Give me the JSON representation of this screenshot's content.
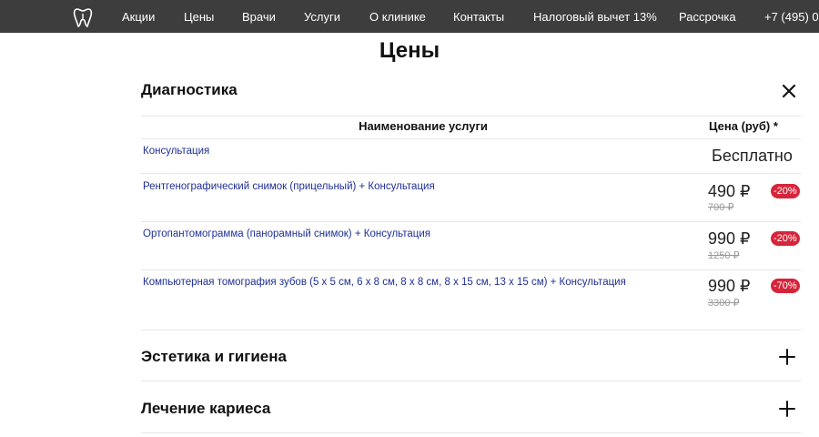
{
  "nav": {
    "items": [
      "Акции",
      "Цены",
      "Врачи",
      "Услуги",
      "О клинике",
      "Контакты",
      "Налоговый вычет 13%",
      "Рассрочка"
    ],
    "phone": "+7 (495) 0"
  },
  "page": {
    "title": "Цены"
  },
  "sections": [
    {
      "title": "Диагностика",
      "state": "expanded",
      "toggle_icon": "close-icon"
    },
    {
      "title": "Эстетика и гигиена",
      "state": "collapsed",
      "toggle_icon": "plus-icon"
    },
    {
      "title": "Лечение кариеса",
      "state": "collapsed",
      "toggle_icon": "plus-icon"
    }
  ],
  "table": {
    "header_name": "Наименование услуги",
    "header_price": "Цена (руб) *",
    "rows": [
      {
        "name": "Консультация",
        "price": "Бесплатно"
      },
      {
        "name": "Рентгенографический снимок (прицельный) + Консультация",
        "price": "490 ₽",
        "old_price": "700 ₽",
        "discount": "-20%"
      },
      {
        "name": "Ортопантомограмма (панорамный снимок) + Консультация",
        "price": "990 ₽",
        "old_price": "1250 ₽",
        "discount": "-20%"
      },
      {
        "name": "Компьютерная томография зубов (5 х 5 см, 6 х 8 см, 8 х 8 см, 8 х 15 см, 13 х 15 см) + Консультация",
        "price": "990 ₽",
        "old_price": "3300 ₽",
        "discount": "-70%"
      }
    ]
  },
  "colors": {
    "nav_bg": "#3d3d3d",
    "link": "#1f2f94",
    "badge": "#d6253b"
  }
}
